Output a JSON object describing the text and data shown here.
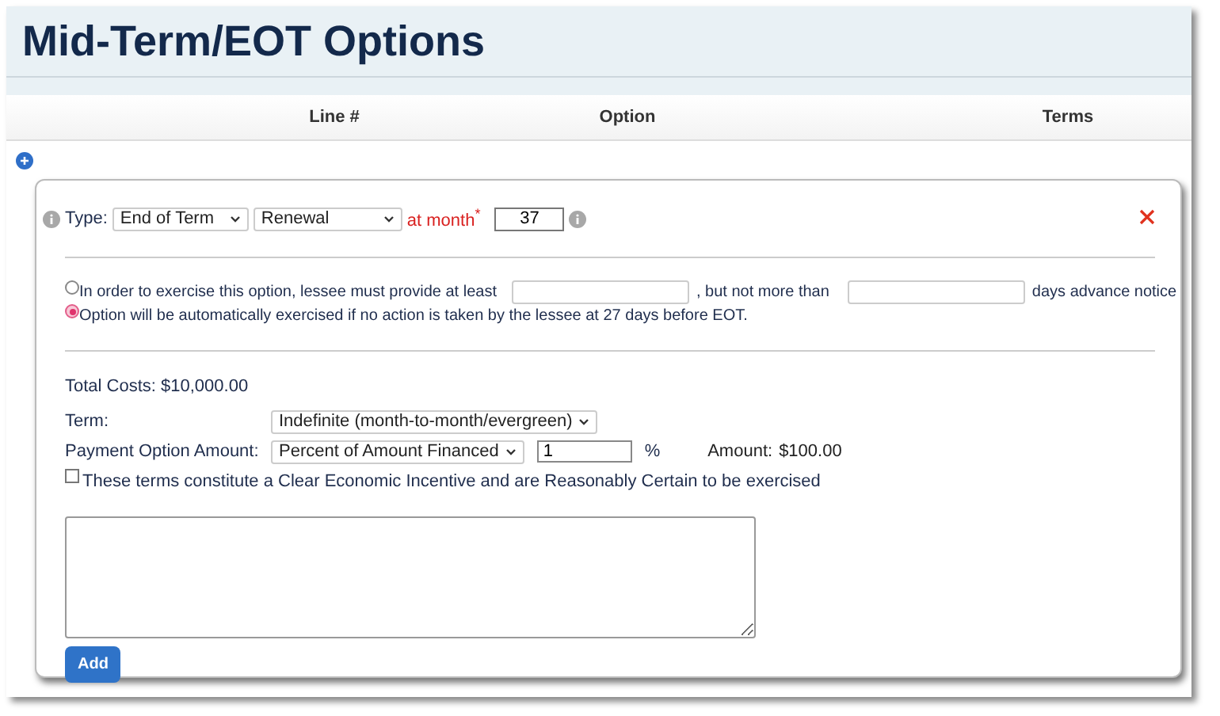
{
  "page": {
    "title": "Mid-Term/EOT Options"
  },
  "table": {
    "columns": [
      "Line #",
      "Option",
      "Terms"
    ]
  },
  "dialog": {
    "type_label": "Type:",
    "type_select": "End of Term",
    "option_select": "Renewal",
    "month_label": "at month",
    "required_mark": "*",
    "month_value": "37",
    "notice_options": [
      {
        "kind": "notice",
        "selected": false,
        "text_before": "In order to exercise this option, lessee must provide at least",
        "text_middle": ", but not more than",
        "text_after": "days advance notice"
      },
      {
        "kind": "auto",
        "selected": true,
        "text": "Option will be automatically exercised if no action is taken by the lessee at 27 days before EOT."
      }
    ],
    "total_costs": "Total Costs: $10,000.00",
    "term": {
      "label": "Term:",
      "value": "Indefinite (month-to-month/evergreen)"
    },
    "payment": {
      "label": "Payment Option Amount:",
      "select": "Percent of Amount Financed",
      "value": "1",
      "unit": "%",
      "amount_label": "Amount:",
      "amount": "$100.00"
    },
    "incentive": {
      "checked": false,
      "label": "These terms constitute a Clear Economic Incentive and are Reasonably Certain to be exercised"
    },
    "add_button": "Add"
  }
}
